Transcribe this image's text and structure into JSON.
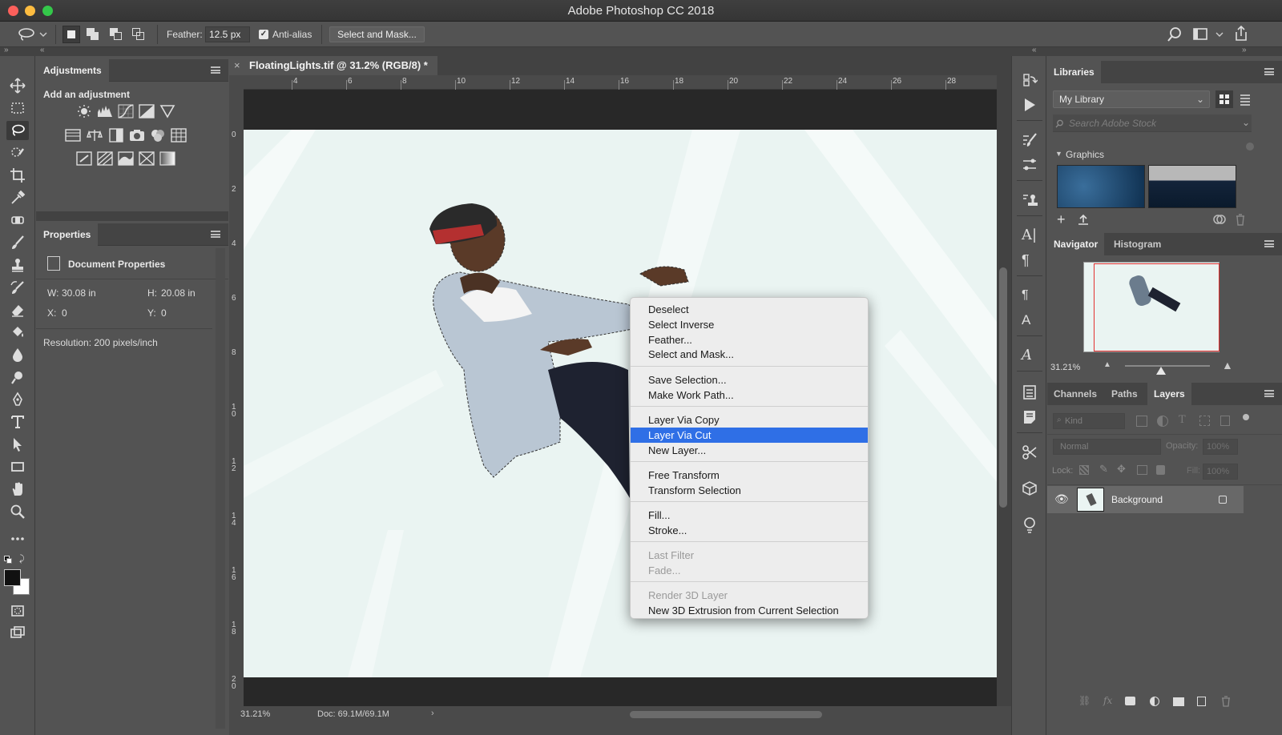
{
  "window": {
    "title": "Adobe Photoshop CC 2018"
  },
  "options_bar": {
    "feather_label": "Feather:",
    "feather_value": "12.5 px",
    "antialias_label": "Anti-alias",
    "antialias_checked": true,
    "select_mask_label": "Select and Mask..."
  },
  "adjustments_panel": {
    "title": "Adjustments",
    "subtitle": "Add an adjustment"
  },
  "properties_panel": {
    "title": "Properties",
    "section": "Document Properties",
    "w_label": "W:",
    "w_value": "30.08 in",
    "h_label": "H:",
    "h_value": "20.08 in",
    "x_label": "X:",
    "x_value": "0",
    "y_label": "Y:",
    "y_value": "0",
    "resolution": "Resolution: 200 pixels/inch"
  },
  "document": {
    "tab_title": "FloatingLights.tif @ 31.2% (RGB/8) *",
    "h_ruler": [
      "4",
      "6",
      "8",
      "10",
      "12",
      "14",
      "16",
      "18",
      "20",
      "22",
      "24",
      "26",
      "28"
    ],
    "v_ruler": [
      "0",
      "2",
      "4",
      "6",
      "8",
      "1\n0",
      "1\n2",
      "1\n4",
      "1\n6",
      "1\n8",
      "2\n0"
    ],
    "zoom": "31.21%",
    "doc_size": "Doc: 69.1M/69.1M"
  },
  "context_menu": {
    "items": [
      {
        "label": "Deselect",
        "state": "normal"
      },
      {
        "label": "Select Inverse",
        "state": "normal"
      },
      {
        "label": "Feather...",
        "state": "normal"
      },
      {
        "label": "Select and Mask...",
        "state": "normal"
      },
      {
        "label": "Save Selection...",
        "state": "normal"
      },
      {
        "label": "Make Work Path...",
        "state": "normal"
      },
      {
        "label": "Layer Via Copy",
        "state": "normal"
      },
      {
        "label": "Layer Via Cut",
        "state": "highlighted"
      },
      {
        "label": "New Layer...",
        "state": "normal"
      },
      {
        "label": "Free Transform",
        "state": "normal"
      },
      {
        "label": "Transform Selection",
        "state": "normal"
      },
      {
        "label": "Fill...",
        "state": "normal"
      },
      {
        "label": "Stroke...",
        "state": "normal"
      },
      {
        "label": "Last Filter",
        "state": "disabled"
      },
      {
        "label": "Fade...",
        "state": "disabled"
      },
      {
        "label": "Render 3D Layer",
        "state": "disabled"
      },
      {
        "label": "New 3D Extrusion from Current Selection",
        "state": "normal"
      }
    ]
  },
  "libraries_panel": {
    "title": "Libraries",
    "library_select": "My Library",
    "search_placeholder": "Search Adobe Stock",
    "group": "Graphics"
  },
  "navigator_panel": {
    "tabs": [
      "Navigator",
      "Histogram"
    ],
    "zoom": "31.21%"
  },
  "layers_panel": {
    "tabs": [
      "Channels",
      "Paths",
      "Layers"
    ],
    "active_tab": "Layers",
    "filter_placeholder": "Kind",
    "blend_mode": "Normal",
    "opacity_label": "Opacity:",
    "opacity_value": "100%",
    "lock_label": "Lock:",
    "fill_label": "Fill:",
    "fill_value": "100%",
    "layers": [
      {
        "name": "Background",
        "visible": true,
        "locked": true
      }
    ]
  },
  "colors": {
    "highlight": "#2f6fe6",
    "panel_bg": "#535353",
    "canvas_bg": "#eef6f5"
  }
}
